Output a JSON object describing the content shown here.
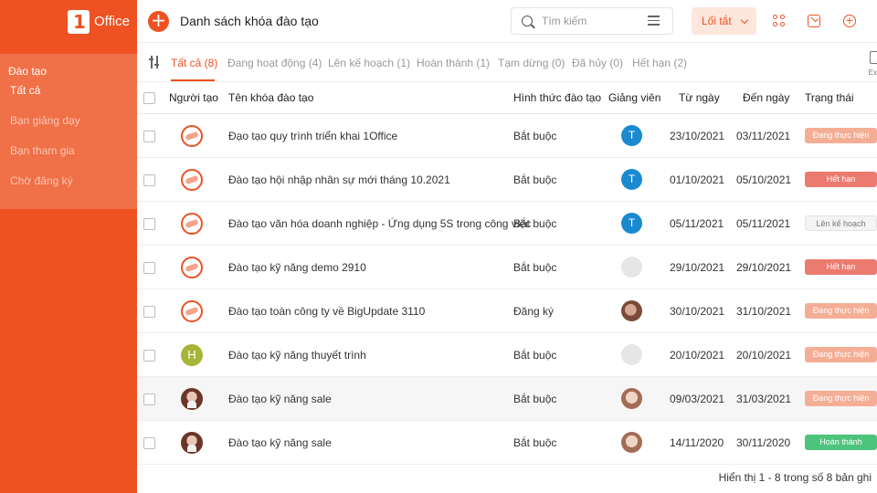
{
  "sidebar": {
    "logo_text": "Office",
    "section_title": "Đào tạo",
    "items": [
      {
        "label": "Tất cả",
        "active": true
      },
      {
        "label": "Bạn giảng dạy"
      },
      {
        "label": "Bạn tham gia"
      },
      {
        "label": "Chờ đăng ký"
      }
    ]
  },
  "header": {
    "add_icon": "plus-circle-icon",
    "title": "Danh sách khóa đào tạo",
    "search_placeholder": "Tìm kiếm",
    "shortcut_label": "Lối tắt"
  },
  "tabs": [
    {
      "label": "Tất cả (8)",
      "active": true
    },
    {
      "label": "Đang hoạt động (4)"
    },
    {
      "label": "Lên kế hoạch (1)"
    },
    {
      "label": "Hoàn thành (1)"
    },
    {
      "label": "Tạm dừng (0)"
    },
    {
      "label": "Đã hủy (0)"
    },
    {
      "label": "Hết hạn (2)"
    }
  ],
  "export_label": "Ex",
  "table": {
    "columns": [
      "Người tạo",
      "Tên khóa đào tạo",
      "Hình thức đào tạo",
      "Giảng viên",
      "Từ ngày",
      "Đến ngày",
      "Trạng thái"
    ],
    "rows": [
      {
        "name": "Đạo tạo quy trình triển khai 1Office",
        "form": "Bắt buộc",
        "teacher": "T",
        "from": "23/10/2021",
        "to": "03/11/2021",
        "status": "Đang thực hiện"
      },
      {
        "name": "Đào tạo hội nhập nhân sự mới tháng 10.2021",
        "form": "Bắt buộc",
        "teacher": "T",
        "from": "01/10/2021",
        "to": "05/10/2021",
        "status": "Hết hạn"
      },
      {
        "name": "Đào tạo văn hóa doanh nghiệp - Ứng dụng 5S trong công việc",
        "form": "Bắt buộc",
        "teacher": "T",
        "from": "05/11/2021",
        "to": "05/11/2021",
        "status": "Lên kế hoạch"
      },
      {
        "name": "Đào tạo kỹ năng demo 2910",
        "form": "Bắt buộc",
        "teacher": "",
        "from": "29/10/2021",
        "to": "29/10/2021",
        "status": "Hết hạn"
      },
      {
        "name": "Đào tạo toàn công ty về BigUpdate 3110",
        "form": "Đăng ký",
        "teacher": "",
        "from": "30/10/2021",
        "to": "31/10/2021",
        "status": "Đang thực hiện"
      },
      {
        "name": "Đào tạo kỹ năng thuyết trình",
        "creator": "H",
        "form": "Bắt buộc",
        "teacher": "",
        "from": "20/10/2021",
        "to": "20/10/2021",
        "status": "Đang thực hiện"
      },
      {
        "name": "Đào tạo kỹ năng sale",
        "form": "Bắt buộc",
        "teacher": "",
        "from": "09/03/2021",
        "to": "31/03/2021",
        "status": "Đang thực hiện"
      },
      {
        "name": "Đào tạo kỹ năng sale",
        "form": "Bắt buộc",
        "teacher": "",
        "from": "14/11/2020",
        "to": "30/11/2020",
        "status": "Hoàn thành"
      }
    ]
  },
  "footer": "Hiển thị 1 - 8 trong số 8 bản ghi",
  "colors": {
    "accent": "#ee5122",
    "expired": "#ec7b6f",
    "active": "#f5ae96",
    "done": "#4dc47b",
    "teacher": "#1a8ad0"
  }
}
